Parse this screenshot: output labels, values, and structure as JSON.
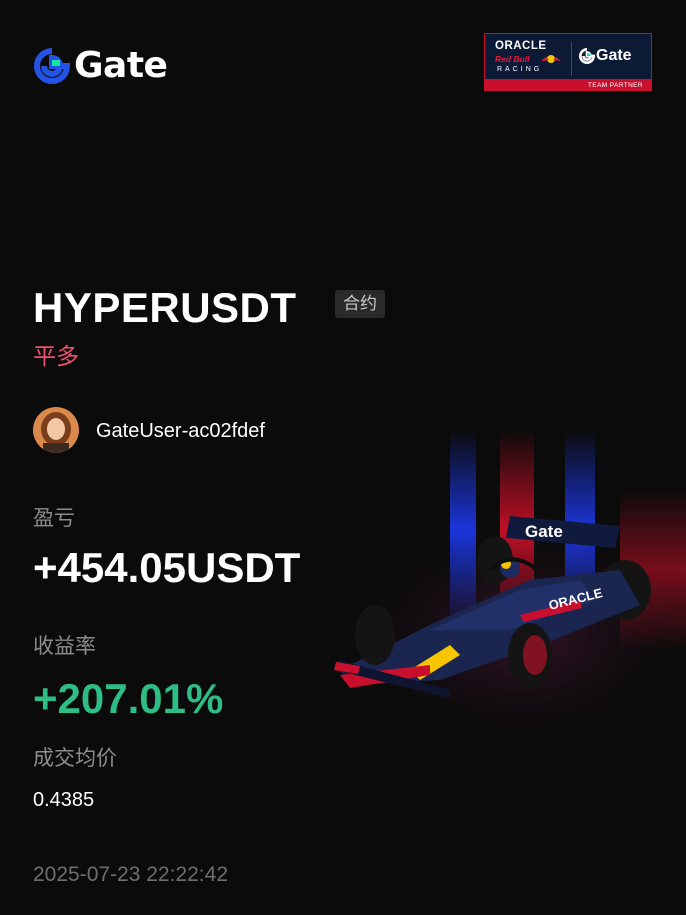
{
  "brand": {
    "name": "Gate",
    "logo_icon": "gate-logo-icon",
    "accent": "#2354e6",
    "accent_secondary": "#17e6a1"
  },
  "partner_badge": {
    "oracle": "ORACLE",
    "redbull": "Red Bull",
    "racing": "RACING",
    "gate": "Gate",
    "strip": "TEAM PARTNER",
    "border_color": "#c8102e"
  },
  "position": {
    "pair": "HYPERUSDT",
    "contract_badge": "合约",
    "side": "平多",
    "side_color": "#f0506e"
  },
  "user": {
    "name": "GateUser-ac02fdef",
    "avatar_icon": "user-avatar"
  },
  "stats": {
    "pnl_label": "盈亏",
    "pnl_value": "+454.05USDT",
    "roi_label": "收益率",
    "roi_value": "+207.01%",
    "roi_color": "#2ebd85",
    "avg_price_label": "成交均价",
    "avg_price_value": "0.4385"
  },
  "timestamp": "2025-07-23 22:22:42",
  "hero_image": "red-bull-f1-car-illustration"
}
